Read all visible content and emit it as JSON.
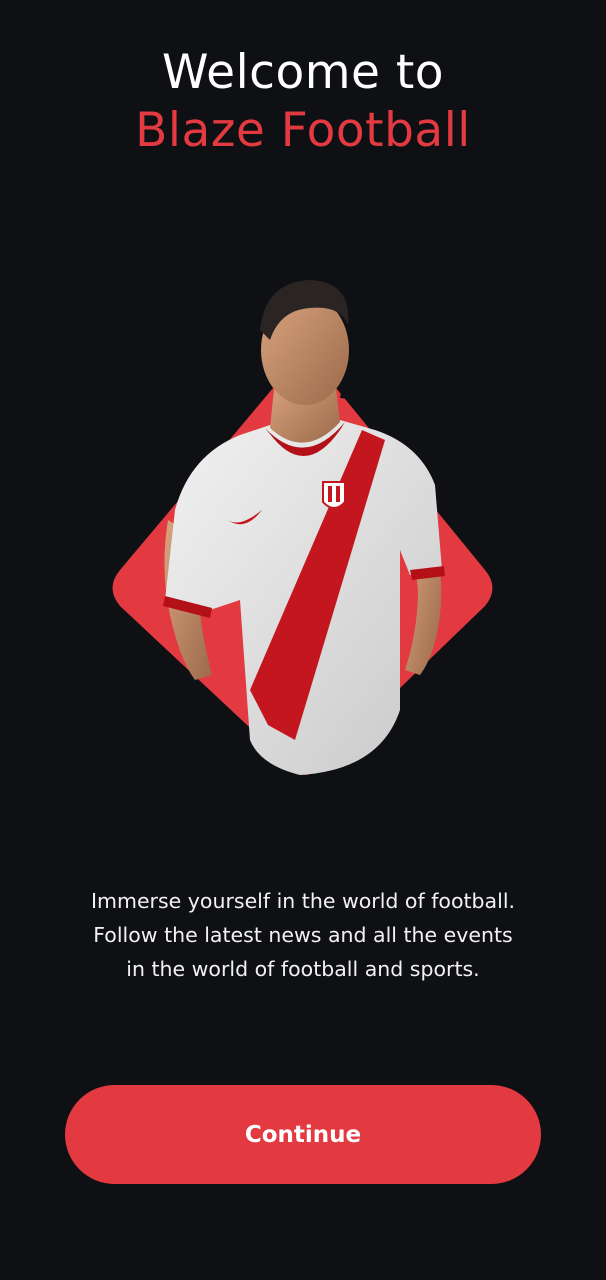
{
  "welcome": {
    "title_line1": "Welcome to",
    "title_line2": "Blaze Football"
  },
  "hero": {
    "image_name": "football-player-illustration",
    "accent_color": "#e23a40"
  },
  "description": {
    "lines": [
      "Immerse yourself in the world of football.",
      "Follow the latest news and all the events",
      "in the world of football and sports."
    ]
  },
  "actions": {
    "continue_label": "Continue"
  },
  "colors": {
    "background": "#0e1014",
    "accent": "#e23a40",
    "text": "#ffffff"
  }
}
